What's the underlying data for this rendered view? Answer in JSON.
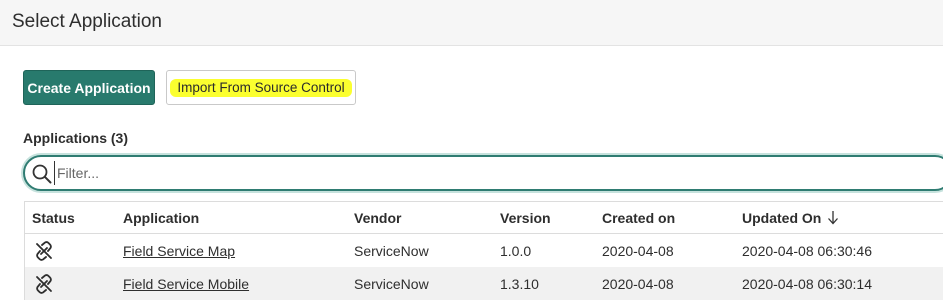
{
  "header": {
    "title": "Select Application"
  },
  "toolbar": {
    "create_label": "Create Application",
    "import_label": "Import From Source Control"
  },
  "applications": {
    "heading": "Applications (3)",
    "filter_placeholder": "Filter...",
    "columns": {
      "status": "Status",
      "application": "Application",
      "vendor": "Vendor",
      "version": "Version",
      "created_on": "Created on",
      "updated_on": "Updated On"
    },
    "rows": [
      {
        "status_icon": "link-broken-icon",
        "application": "Field Service Map",
        "vendor": "ServiceNow",
        "version": "1.0.0",
        "created_on": "2020-04-08",
        "updated_on": "2020-04-08 06:30:46"
      },
      {
        "status_icon": "link-broken-icon",
        "application": "Field Service Mobile",
        "vendor": "ServiceNow",
        "version": "1.3.10",
        "created_on": "2020-04-08",
        "updated_on": "2020-04-08 06:30:14"
      }
    ]
  },
  "colors": {
    "primary": "#287a6d",
    "highlight": "#fbff2f",
    "filter_border": "#2f7c72"
  }
}
